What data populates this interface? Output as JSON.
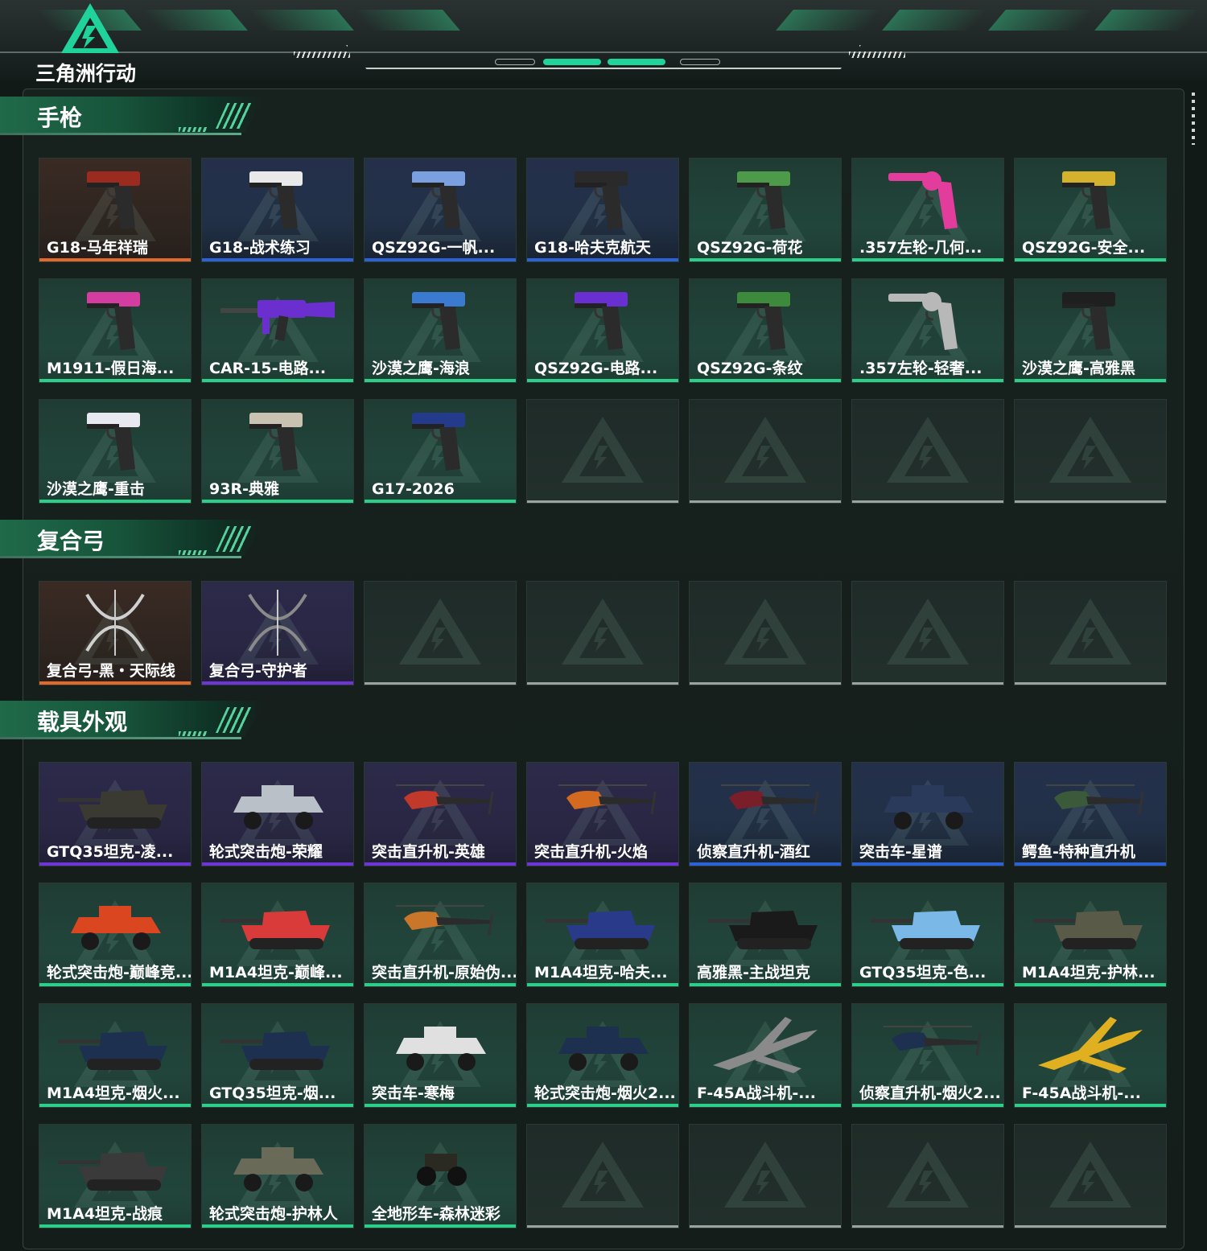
{
  "app": {
    "logo_text": "三角洲行动",
    "accent": "#1fd39a"
  },
  "sections": [
    {
      "title": "手枪",
      "items": [
        {
          "label": "G18-马年祥瑞",
          "quality": "orange",
          "icon": "pistol-icon",
          "color": "#9b2a1f"
        },
        {
          "label": "G18-战术练习",
          "quality": "blue",
          "icon": "pistol-icon",
          "color": "#e9e9e9"
        },
        {
          "label": "QSZ92G-一帆...",
          "quality": "blue",
          "icon": "pistol-icon",
          "color": "#7aa0e0"
        },
        {
          "label": "G18-哈夫克航天",
          "quality": "blue",
          "icon": "pistol-icon",
          "color": "#2a2a2a"
        },
        {
          "label": "QSZ92G-荷花",
          "quality": "green",
          "icon": "pistol-icon",
          "color": "#4d9b4a"
        },
        {
          "label": ".357左轮-几何...",
          "quality": "green",
          "icon": "revolver-icon",
          "color": "#e23c9d"
        },
        {
          "label": "QSZ92G-安全...",
          "quality": "green",
          "icon": "pistol-icon",
          "color": "#d4b22d"
        },
        {
          "label": "M1911-假日海...",
          "quality": "green",
          "icon": "pistol-icon",
          "color": "#d43da0"
        },
        {
          "label": "CAR-15-电路...",
          "quality": "green",
          "icon": "rifle-icon",
          "color": "#6b2fd0"
        },
        {
          "label": "沙漠之鹰-海浪",
          "quality": "green",
          "icon": "pistol-icon",
          "color": "#3a7ad0"
        },
        {
          "label": "QSZ92G-电路...",
          "quality": "green",
          "icon": "pistol-icon",
          "color": "#6a2fd0"
        },
        {
          "label": "QSZ92G-条纹",
          "quality": "green",
          "icon": "pistol-icon",
          "color": "#3e8a3c"
        },
        {
          "label": ".357左轮-轻奢...",
          "quality": "green",
          "icon": "revolver-icon",
          "color": "#b8b8b8"
        },
        {
          "label": "沙漠之鹰-高雅黑",
          "quality": "green",
          "icon": "pistol-icon",
          "color": "#1f1f1f"
        },
        {
          "label": "沙漠之鹰-重击",
          "quality": "green",
          "icon": "pistol-icon",
          "color": "#e8e8f0"
        },
        {
          "label": "93R-典雅",
          "quality": "green",
          "icon": "pistol-icon",
          "color": "#c9c2b0"
        },
        {
          "label": "G17-2026",
          "quality": "green",
          "icon": "pistol-icon",
          "color": "#243a8a"
        },
        {
          "label": "",
          "quality": "empty"
        },
        {
          "label": "",
          "quality": "empty"
        },
        {
          "label": "",
          "quality": "empty"
        },
        {
          "label": "",
          "quality": "empty"
        }
      ]
    },
    {
      "title": "复合弓",
      "items": [
        {
          "label": "复合弓-黑・天际线",
          "quality": "orange",
          "icon": "bow-icon",
          "color": "#d0d0d0"
        },
        {
          "label": "复合弓-守护者",
          "quality": "purple",
          "icon": "bow-icon",
          "color": "#8a8a8a"
        },
        {
          "label": "",
          "quality": "empty"
        },
        {
          "label": "",
          "quality": "empty"
        },
        {
          "label": "",
          "quality": "empty"
        },
        {
          "label": "",
          "quality": "empty"
        },
        {
          "label": "",
          "quality": "empty"
        }
      ]
    },
    {
      "title": "载具外观",
      "items": [
        {
          "label": "GTQ35坦克-凌...",
          "quality": "purple",
          "icon": "tank-icon",
          "color": "#3a3a32"
        },
        {
          "label": "轮式突击炮-荣耀",
          "quality": "purple",
          "icon": "armored-car-icon",
          "color": "#b9c0c8"
        },
        {
          "label": "突击直升机-英雄",
          "quality": "purple",
          "icon": "helicopter-icon",
          "color": "#c0392b"
        },
        {
          "label": "突击直升机-火焰",
          "quality": "purple",
          "icon": "helicopter-icon",
          "color": "#d46a1f"
        },
        {
          "label": "侦察直升机-酒红",
          "quality": "blue",
          "icon": "helicopter-icon",
          "color": "#7a1f2a"
        },
        {
          "label": "突击车-星谱",
          "quality": "blue",
          "icon": "armored-car-icon",
          "color": "#2a3a5a"
        },
        {
          "label": "鳄鱼-特种直升机",
          "quality": "blue",
          "icon": "helicopter-icon",
          "color": "#3a5a3a"
        },
        {
          "label": "轮式突击炮-巅峰竞...",
          "quality": "green",
          "icon": "armored-car-icon",
          "color": "#d9461f"
        },
        {
          "label": "M1A4坦克-巅峰...",
          "quality": "green",
          "icon": "tank-icon",
          "color": "#d93a3a"
        },
        {
          "label": "突击直升机-原始伪...",
          "quality": "green",
          "icon": "helicopter-icon",
          "color": "#c9762a"
        },
        {
          "label": "M1A4坦克-哈夫...",
          "quality": "green",
          "icon": "tank-icon",
          "color": "#2a3a8a"
        },
        {
          "label": "高雅黑-主战坦克",
          "quality": "green",
          "icon": "tank-icon",
          "color": "#1a1a1a"
        },
        {
          "label": "GTQ35坦克-色...",
          "quality": "green",
          "icon": "tank-icon",
          "color": "#7ab8e8"
        },
        {
          "label": "M1A4坦克-护林...",
          "quality": "green",
          "icon": "tank-icon",
          "color": "#5a5a48"
        },
        {
          "label": "M1A4坦克-烟火...",
          "quality": "green",
          "icon": "tank-icon",
          "color": "#1e3050"
        },
        {
          "label": "GTQ35坦克-烟...",
          "quality": "green",
          "icon": "tank-icon",
          "color": "#1e3050"
        },
        {
          "label": "突击车-寒梅",
          "quality": "green",
          "icon": "armored-car-icon",
          "color": "#e0e0e0"
        },
        {
          "label": "轮式突击炮-烟火2...",
          "quality": "green",
          "icon": "armored-car-icon",
          "color": "#1e3050"
        },
        {
          "label": "F-45A战斗机-...",
          "quality": "green",
          "icon": "jet-icon",
          "color": "#8a8a8a"
        },
        {
          "label": "侦察直升机-烟火2...",
          "quality": "green",
          "icon": "helicopter-icon",
          "color": "#1e3050"
        },
        {
          "label": "F-45A战斗机-...",
          "quality": "green",
          "icon": "jet-icon",
          "color": "#e0b020"
        },
        {
          "label": "M1A4坦克-战痕",
          "quality": "green",
          "icon": "tank-icon",
          "color": "#3a3a3a"
        },
        {
          "label": "轮式突击炮-护林人",
          "quality": "green",
          "icon": "armored-car-icon",
          "color": "#6a6a58"
        },
        {
          "label": "全地形车-森林迷彩",
          "quality": "green",
          "icon": "atv-icon",
          "color": "#2a2a22"
        },
        {
          "label": "",
          "quality": "empty"
        },
        {
          "label": "",
          "quality": "empty"
        },
        {
          "label": "",
          "quality": "empty"
        },
        {
          "label": "",
          "quality": "empty"
        }
      ]
    }
  ]
}
